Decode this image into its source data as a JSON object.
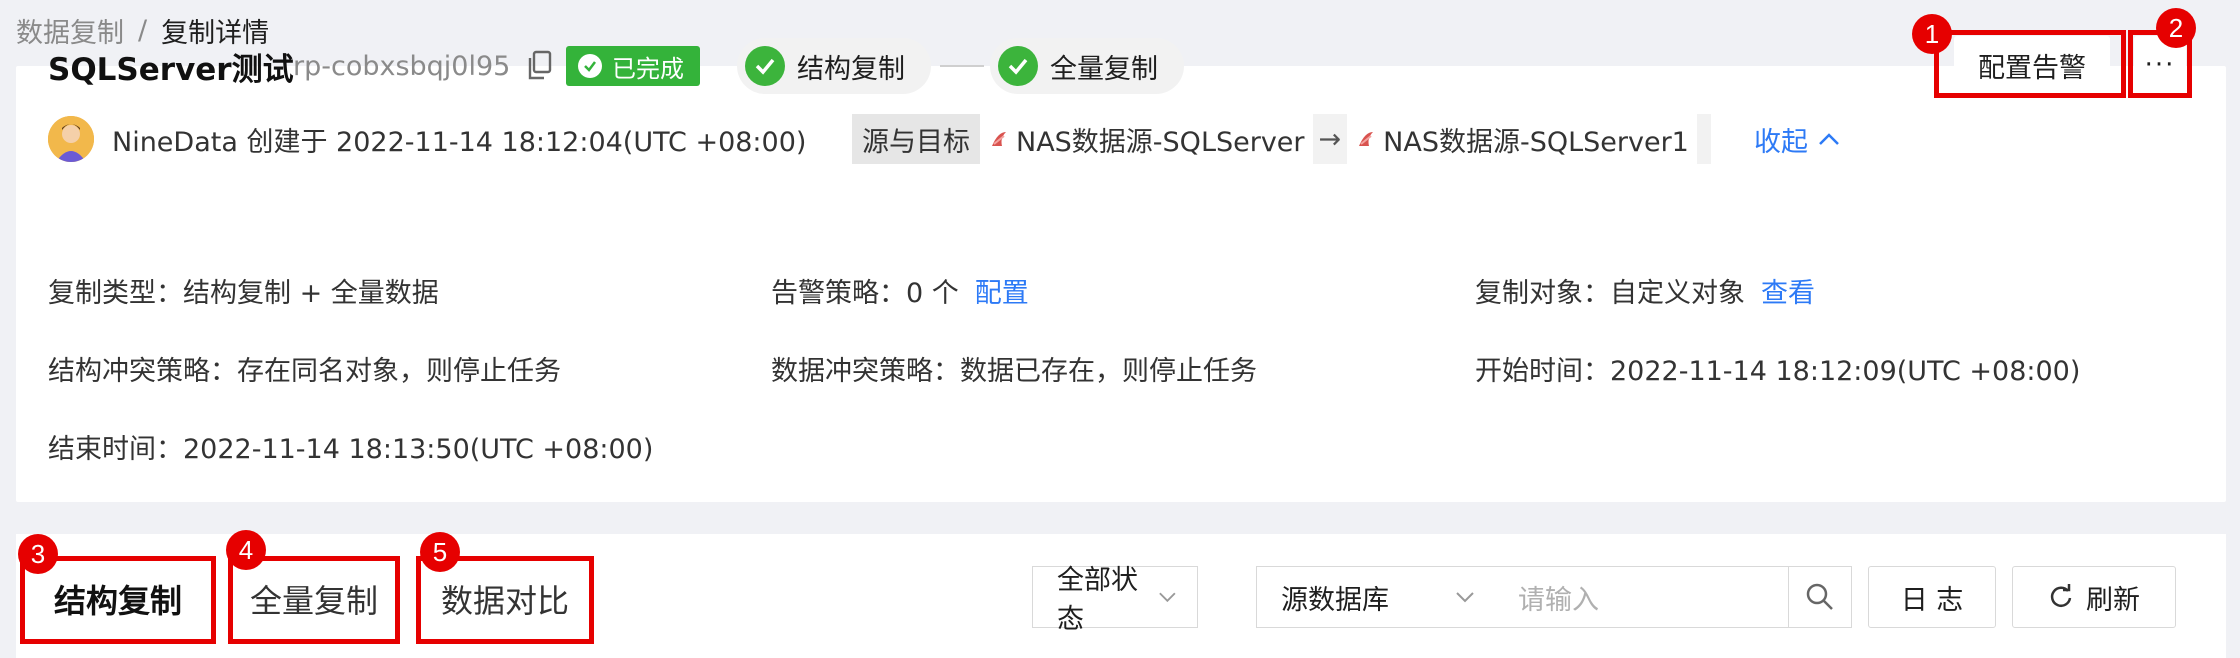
{
  "breadcrumb": {
    "parent": "数据复制",
    "separator": "/",
    "current": "复制详情"
  },
  "header": {
    "title": "SQLServer测试",
    "task_id": "rp-cobxsbqj0l95",
    "status": "已完成",
    "steps": [
      {
        "label": "结构复制"
      },
      {
        "label": "全量复制"
      }
    ],
    "alarm_button": "配置告警",
    "more_button": "···"
  },
  "meta": {
    "creator": "NineData 创建于 2022-11-14 18:12:04(UTC +08:00)",
    "source_target_label": "源与目标",
    "source": "NAS数据源-SQLServer",
    "arrow": "→",
    "target": "NAS数据源-SQLServer1",
    "collapse": "收起"
  },
  "details": {
    "copy_type": "复制类型：结构复制 + 全量数据",
    "alarm_policy": "告警策略：0 个",
    "alarm_policy_link": "配置",
    "copy_object": "复制对象：自定义对象",
    "copy_object_link": "查看",
    "struct_conflict": "结构冲突策略：存在同名对象，则停止任务",
    "data_conflict": "数据冲突策略：数据已存在，则停止任务",
    "start_time": "开始时间：2022-11-14 18:12:09(UTC +08:00)",
    "end_time": "结束时间：2022-11-14 18:13:50(UTC +08:00)"
  },
  "tabs": [
    {
      "label": "结构复制",
      "active": true
    },
    {
      "label": "全量复制",
      "active": false
    },
    {
      "label": "数据对比",
      "active": false
    }
  ],
  "toolbar": {
    "status_select": "全部状态",
    "db_select": "源数据库",
    "search_placeholder": "请输入",
    "log_button": "日 志",
    "refresh_button": "刷新"
  },
  "markers": [
    "1",
    "2",
    "3",
    "4",
    "5"
  ],
  "colors": {
    "accent": "#2d7af6",
    "success": "#34b33a",
    "annotation": "#e60000"
  }
}
